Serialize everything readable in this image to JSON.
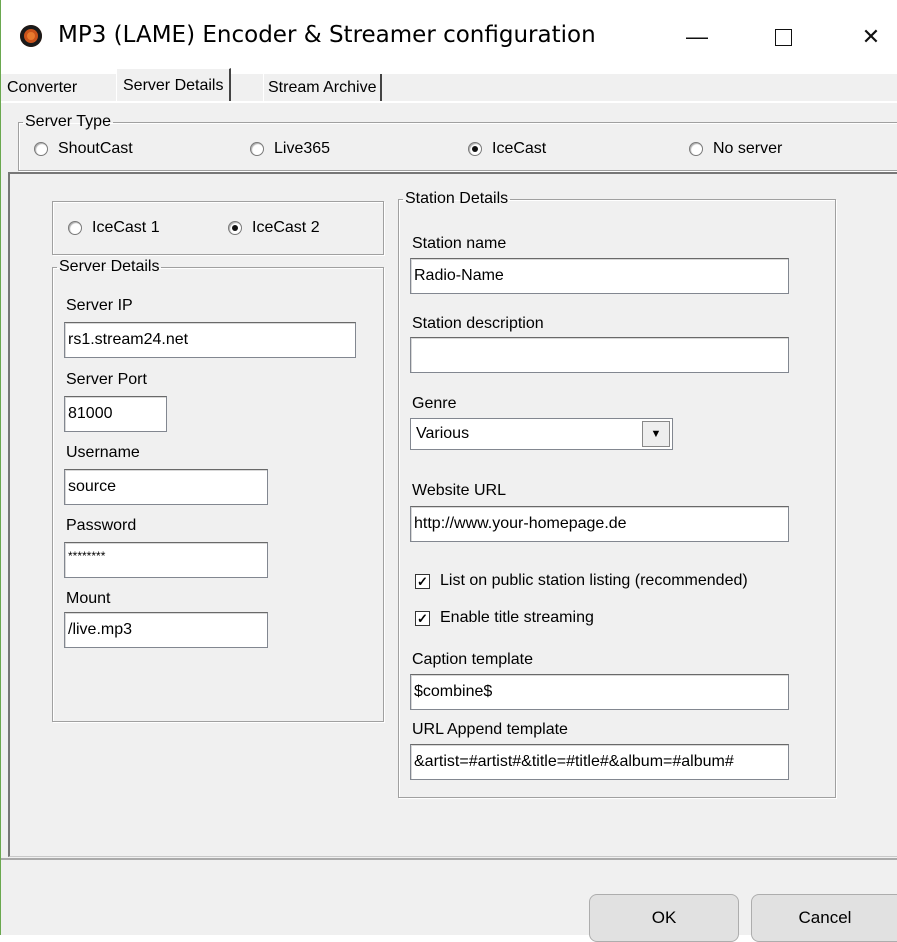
{
  "window": {
    "title": "MP3 (LAME) Encoder & Streamer configuration",
    "minimize_glyph": "—",
    "close_glyph": "✕"
  },
  "tabs": [
    {
      "label": "Converter",
      "selected": false
    },
    {
      "label": "Server Details",
      "selected": true
    },
    {
      "label": "Stream Archive",
      "selected": false
    }
  ],
  "server_type": {
    "legend": "Server Type",
    "options": [
      {
        "label": "ShoutCast",
        "selected": false
      },
      {
        "label": "Live365",
        "selected": false
      },
      {
        "label": "IceCast",
        "selected": true
      },
      {
        "label": "No server",
        "selected": false
      }
    ]
  },
  "icecast_version": {
    "options": [
      {
        "label": "IceCast 1",
        "selected": false
      },
      {
        "label": "IceCast 2",
        "selected": true
      }
    ]
  },
  "server_details": {
    "legend": "Server Details",
    "server_ip_label": "Server IP",
    "server_ip_value": "rs1.stream24.net",
    "server_port_label": "Server Port",
    "server_port_value": "81000",
    "username_label": "Username",
    "username_value": "source",
    "password_label": "Password",
    "password_value": "********",
    "mount_label": "Mount",
    "mount_value": "/live.mp3"
  },
  "station_details": {
    "legend": "Station Details",
    "station_name_label": "Station name",
    "station_name_value": "Radio-Name",
    "station_description_label": "Station description",
    "station_description_value": "",
    "genre_label": "Genre",
    "genre_value": "Various",
    "website_url_label": "Website URL",
    "website_url_value": "http://www.your-homepage.de",
    "list_public_label": "List on public station listing (recommended)",
    "list_public_checked": true,
    "title_streaming_label": "Enable title streaming",
    "title_streaming_checked": true,
    "caption_template_label": "Caption template",
    "caption_template_value": "$combine$",
    "url_append_label": "URL Append template",
    "url_append_value": "&artist=#artist#&title=#title#&album=#album#"
  },
  "buttons": {
    "ok_label": "OK",
    "cancel_label": "Cancel"
  },
  "colors": {
    "window_bg": "#f0f0f0",
    "app_icon": "#c9521a",
    "frame_accent": "#6aa84f"
  }
}
